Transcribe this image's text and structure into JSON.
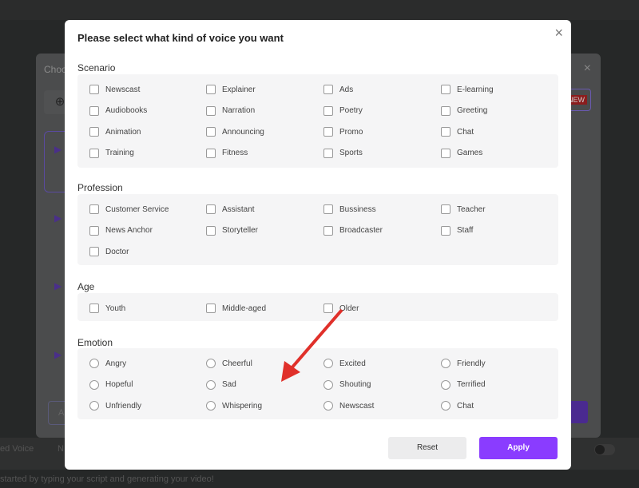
{
  "background": {
    "back_title": "Choo",
    "new_badge": "NEW",
    "back_button": "A",
    "bottom_label": "ed Voice",
    "bottom_label2": "N",
    "status_text": "started by typing your script and generating your video!"
  },
  "modal": {
    "title": "Please select what kind of voice you want",
    "close_icon": "×",
    "sections": [
      {
        "label": "Scenario",
        "type": "checkbox",
        "rows": [
          [
            "Newscast",
            "Explainer",
            "Ads",
            "E-learning"
          ],
          [
            "Audiobooks",
            "Narration",
            "Poetry",
            "Greeting"
          ],
          [
            "Animation",
            "Announcing",
            "Promo",
            "Chat"
          ],
          [
            "Training",
            "Fitness",
            "Sports",
            "Games"
          ]
        ]
      },
      {
        "label": "Profession",
        "type": "checkbox",
        "rows": [
          [
            "Customer Service",
            "Assistant",
            "Bussiness",
            "Teacher"
          ],
          [
            "News Anchor",
            "Storyteller",
            "Broadcaster",
            "Staff"
          ],
          [
            "Doctor"
          ]
        ]
      },
      {
        "label": "Age",
        "type": "checkbox",
        "rows": [
          [
            "Youth",
            "Middle-aged",
            "Older"
          ]
        ]
      },
      {
        "label": "Emotion",
        "type": "radio",
        "rows": [
          [
            "Angry",
            "Cheerful",
            "Excited",
            "Friendly"
          ],
          [
            "Hopeful",
            "Sad",
            "Shouting",
            "Terrified"
          ],
          [
            "Unfriendly",
            "Whispering",
            "Newscast",
            "Chat"
          ]
        ]
      }
    ],
    "reset_label": "Reset",
    "apply_label": "Apply"
  },
  "annotation": {
    "highlighted_option": "Whispering",
    "highlight_color": "#e0302a"
  },
  "colors": {
    "accent": "#8a3cff"
  }
}
